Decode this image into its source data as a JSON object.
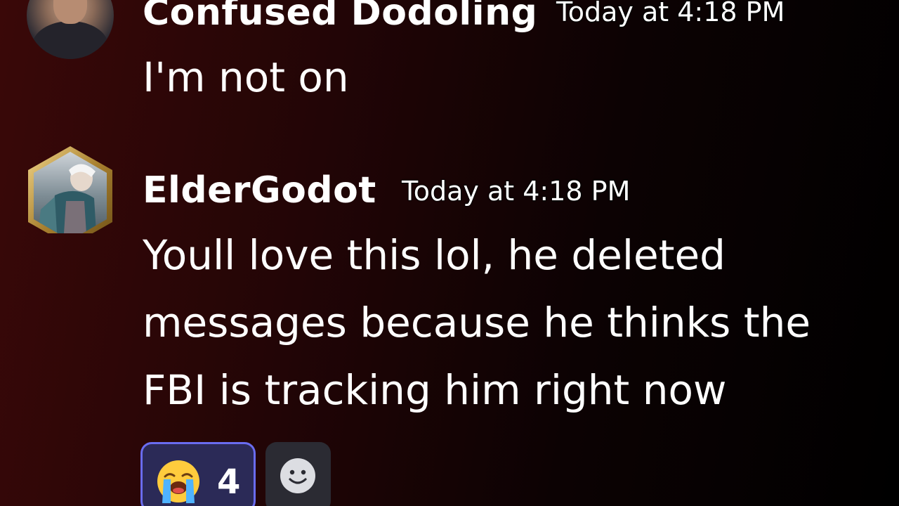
{
  "messages": [
    {
      "username": "Confused Dodoling",
      "timestamp": "Today at 4:18 PM",
      "text": "I'm not on"
    },
    {
      "username": "ElderGodot",
      "timestamp": "Today at 4:18 PM",
      "text": "Youll love this lol, he deleted messages because he thinks the FBI is tracking him right now",
      "reactions": [
        {
          "emoji": "loudly-crying-face",
          "count": "4",
          "active": true
        }
      ],
      "add_reaction_icon": "smiley-face-icon"
    }
  ],
  "colors": {
    "reaction_active_bg": "#2b2a57",
    "reaction_active_border": "#6a6cf0",
    "add_reaction_bg": "#2b2b33"
  }
}
